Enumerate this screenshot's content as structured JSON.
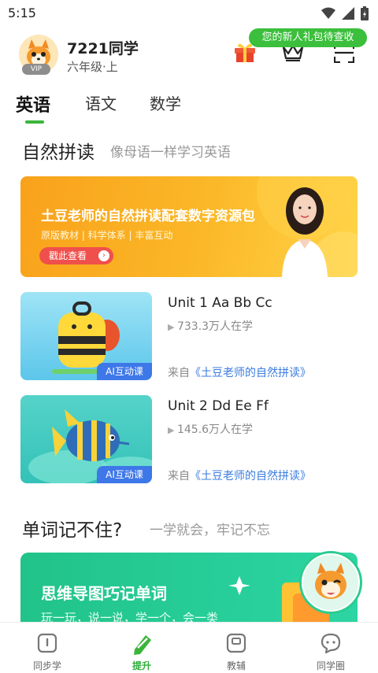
{
  "status_bar": {
    "time": "5:15"
  },
  "header": {
    "user_name": "7221同学",
    "grade": "六年级·上",
    "vip_label": "VIP",
    "gift_tooltip": "您的新人礼包待查收"
  },
  "tabs": [
    {
      "label": "英语",
      "active": true
    },
    {
      "label": "语文",
      "active": false
    },
    {
      "label": "数学",
      "active": false
    }
  ],
  "phonics_section": {
    "title": "自然拼读",
    "subtitle": "像母语一样学习英语"
  },
  "banner": {
    "title": "土豆老师的自然拼读配套数字资源包",
    "features": "原版教材 | 科学体系 | 丰富互动",
    "cta": "戳此查看"
  },
  "courses": [
    {
      "title": "Unit 1 Aa Bb Cc",
      "learners": "733.3万人在学",
      "badge": "AI互动课",
      "source_prefix": "来自",
      "source_link": "《土豆老师的自然拼读》"
    },
    {
      "title": "Unit 2 Dd Ee Ff",
      "learners": "145.6万人在学",
      "badge": "AI互动课",
      "source_prefix": "来自",
      "source_link": "《土豆老师的自然拼读》"
    }
  ],
  "vocab_section": {
    "title": "单词记不住?",
    "subtitle": "一学就会，牢记不忘"
  },
  "mindmap_banner": {
    "title": "思维导图巧记单词",
    "subtitle": "玩一玩，说一说，学一个，会一类"
  },
  "bottom_nav": [
    {
      "label": "同步学",
      "icon": "book-icon",
      "active": false
    },
    {
      "label": "提升",
      "icon": "pencil-icon",
      "active": true
    },
    {
      "label": "教辅",
      "icon": "notebook-icon",
      "active": false
    },
    {
      "label": "同学圈",
      "icon": "chat-bubble-icon",
      "active": false
    }
  ],
  "colors": {
    "accent_green": "#3ab53a",
    "banner_orange": "#f9a21b",
    "badge_blue": "#3e77e8",
    "link_blue": "#3a7ce0"
  }
}
